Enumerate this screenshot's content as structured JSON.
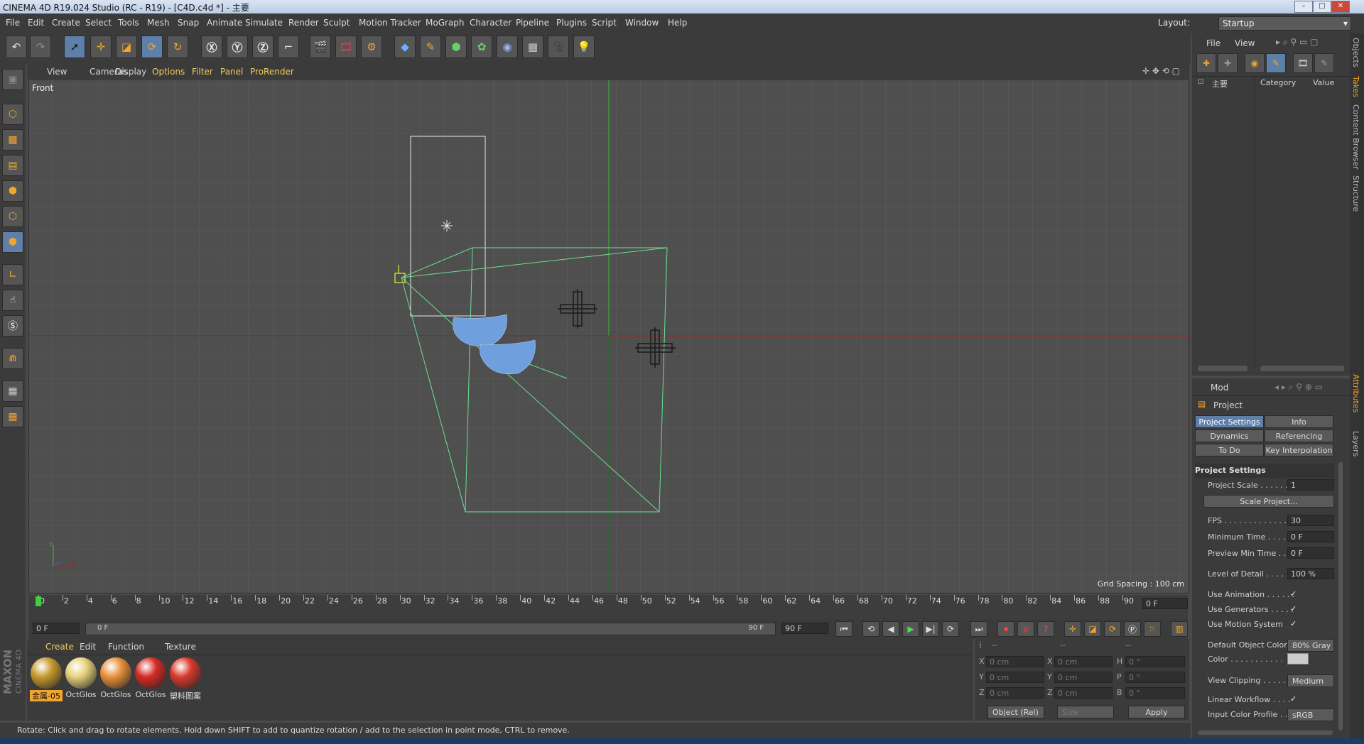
{
  "window": {
    "title": "CINEMA 4D R19.024 Studio (RC - R19) - [C4D.c4d *] - 主要"
  },
  "menu": [
    "File",
    "Edit",
    "Create",
    "Select",
    "Tools",
    "Mesh",
    "Snap",
    "Animate",
    "Simulate",
    "Render",
    "Sculpt",
    "Motion Tracker",
    "MoGraph",
    "Character",
    "Pipeline",
    "Plugins",
    "Script",
    "Window",
    "Help"
  ],
  "layout": {
    "label": "Layout:",
    "value": "Startup"
  },
  "viewport_menu": [
    "View",
    "Cameras",
    "Display",
    "Options",
    "Filter",
    "Panel",
    "ProRender"
  ],
  "viewport": {
    "name": "Front",
    "grid_spacing": "Grid Spacing : 100 cm"
  },
  "axis_labels": {
    "y": "Y",
    "x": "X"
  },
  "timeline": {
    "ticks": [
      "0",
      "2",
      "4",
      "6",
      "8",
      "10",
      "12",
      "14",
      "16",
      "18",
      "20",
      "22",
      "24",
      "26",
      "28",
      "30",
      "32",
      "34",
      "36",
      "38",
      "40",
      "42",
      "44",
      "46",
      "48",
      "50",
      "52",
      "54",
      "56",
      "58",
      "60",
      "62",
      "64",
      "66",
      "68",
      "70",
      "72",
      "74",
      "76",
      "78",
      "80",
      "82",
      "84",
      "86",
      "88",
      "90"
    ],
    "current": "0 F"
  },
  "transport": {
    "start": "0 F",
    "range_start": "0 F",
    "range_end": "90 F",
    "end": "90 F"
  },
  "material_menu": [
    "Create",
    "Edit",
    "Function",
    "Texture"
  ],
  "materials": [
    {
      "label": "金属-05",
      "color": "#c89a2e"
    },
    {
      "label": "OctGlos",
      "color": "#e5d27a"
    },
    {
      "label": "OctGlos",
      "color": "#e8913a"
    },
    {
      "label": "OctGlos",
      "color": "#d62b24"
    },
    {
      "label": "塑料图案",
      "color": "#d93a2b"
    }
  ],
  "coords": {
    "header": [
      "--",
      "--",
      "--"
    ],
    "rows": [
      {
        "a": "X",
        "av": "0 cm",
        "b": "X",
        "bv": "0 cm",
        "c": "H",
        "cv": "0 °"
      },
      {
        "a": "Y",
        "av": "0 cm",
        "b": "Y",
        "bv": "0 cm",
        "c": "P",
        "cv": "0 °"
      },
      {
        "a": "Z",
        "av": "0 cm",
        "b": "Z",
        "bv": "0 cm",
        "c": "B",
        "cv": "0 °"
      }
    ],
    "mode": "Object (Rel)",
    "size": "Size",
    "apply": "Apply"
  },
  "status": "Rotate: Click and drag to rotate elements. Hold down SHIFT to add to quantize rotation / add to the selection in point mode, CTRL to remove.",
  "objects_panel": {
    "menu": [
      "File",
      "View"
    ],
    "root": "主要",
    "col_category": "Category",
    "col_value": "Value"
  },
  "attributes": {
    "menu": "Mod",
    "title": "Project",
    "tabs": [
      "Project Settings",
      "Info",
      "Dynamics",
      "Referencing",
      "To Do",
      "Key Interpolation"
    ],
    "section": "Project Settings",
    "scale_button": "Scale Project...",
    "props": [
      {
        "label": "Project Scale . . . . . . .",
        "value": "1"
      },
      {
        "label": "FPS . . . . . . . . . . . . . . .",
        "value": "30"
      },
      {
        "label": "Minimum Time . . . . . .",
        "value": "0 F"
      },
      {
        "label": "Preview Min Time . . .",
        "value": "0 F"
      },
      {
        "label": "Level of Detail . . . . . .",
        "value": "100 %"
      },
      {
        "label": "Use Animation . . . . . .",
        "value": "✓"
      },
      {
        "label": "Use Generators . . . . .",
        "value": "✓"
      },
      {
        "label": "Use Motion System",
        "value": "✓"
      },
      {
        "label": "Default Object Color",
        "value": "80% Gray"
      },
      {
        "label": "Color . . . . . . . . . . .",
        "value": ""
      },
      {
        "label": "View Clipping . . . . . .",
        "value": "Medium"
      },
      {
        "label": "Linear Workflow . . . .",
        "value": "✓"
      },
      {
        "label": "Input Color Profile . .",
        "value": "sRGB"
      }
    ]
  },
  "side_tabs": [
    "Objects",
    "Takes",
    "Content Browser",
    "Structure",
    "Attributes",
    "Layers"
  ],
  "brand": {
    "name": "MAXON",
    "product": "CINEMA 4D"
  }
}
